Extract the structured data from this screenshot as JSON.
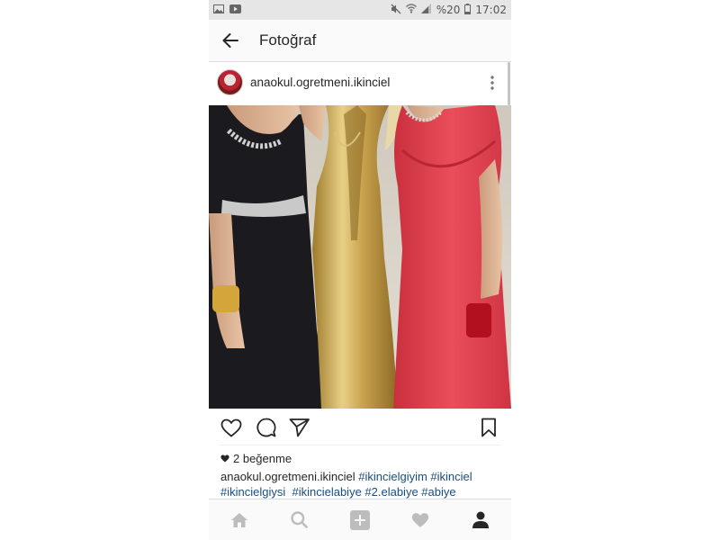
{
  "status_bar": {
    "battery_text": "%20",
    "time": "17:02",
    "icons": [
      "gallery-icon",
      "youtube-icon",
      "mute-icon",
      "wifi-icon",
      "signal-icon",
      "battery-icon"
    ]
  },
  "app_bar": {
    "title": "Fotoğraf",
    "back_icon": "arrow-left-icon"
  },
  "post": {
    "username": "anaokul.ogretmeni.ikinciel",
    "more_icon": "more-vertical-icon",
    "photo_alt": "three women in evening gowns: black, gold, red",
    "likes_text": "2 beğenme",
    "caption": {
      "username": "anaokul.ogretmeni.ikinciel",
      "line1_tags": "#ikincielgiyim #ikinciel",
      "line2_tags": "#ikincielgiysi  #ikincielabiye #2.elabiye #abiye"
    }
  },
  "actions": [
    "heart-icon",
    "comment-icon",
    "share-icon",
    "bookmark-icon"
  ],
  "tab_bar": [
    "home-icon",
    "search-icon",
    "add-icon",
    "activity-icon",
    "profile-icon"
  ],
  "colors": {
    "hashtag": "#1a4d80",
    "gown_red": "#e2434f",
    "gown_gold": "#c9a24a",
    "gown_black": "#1b1b1f"
  }
}
